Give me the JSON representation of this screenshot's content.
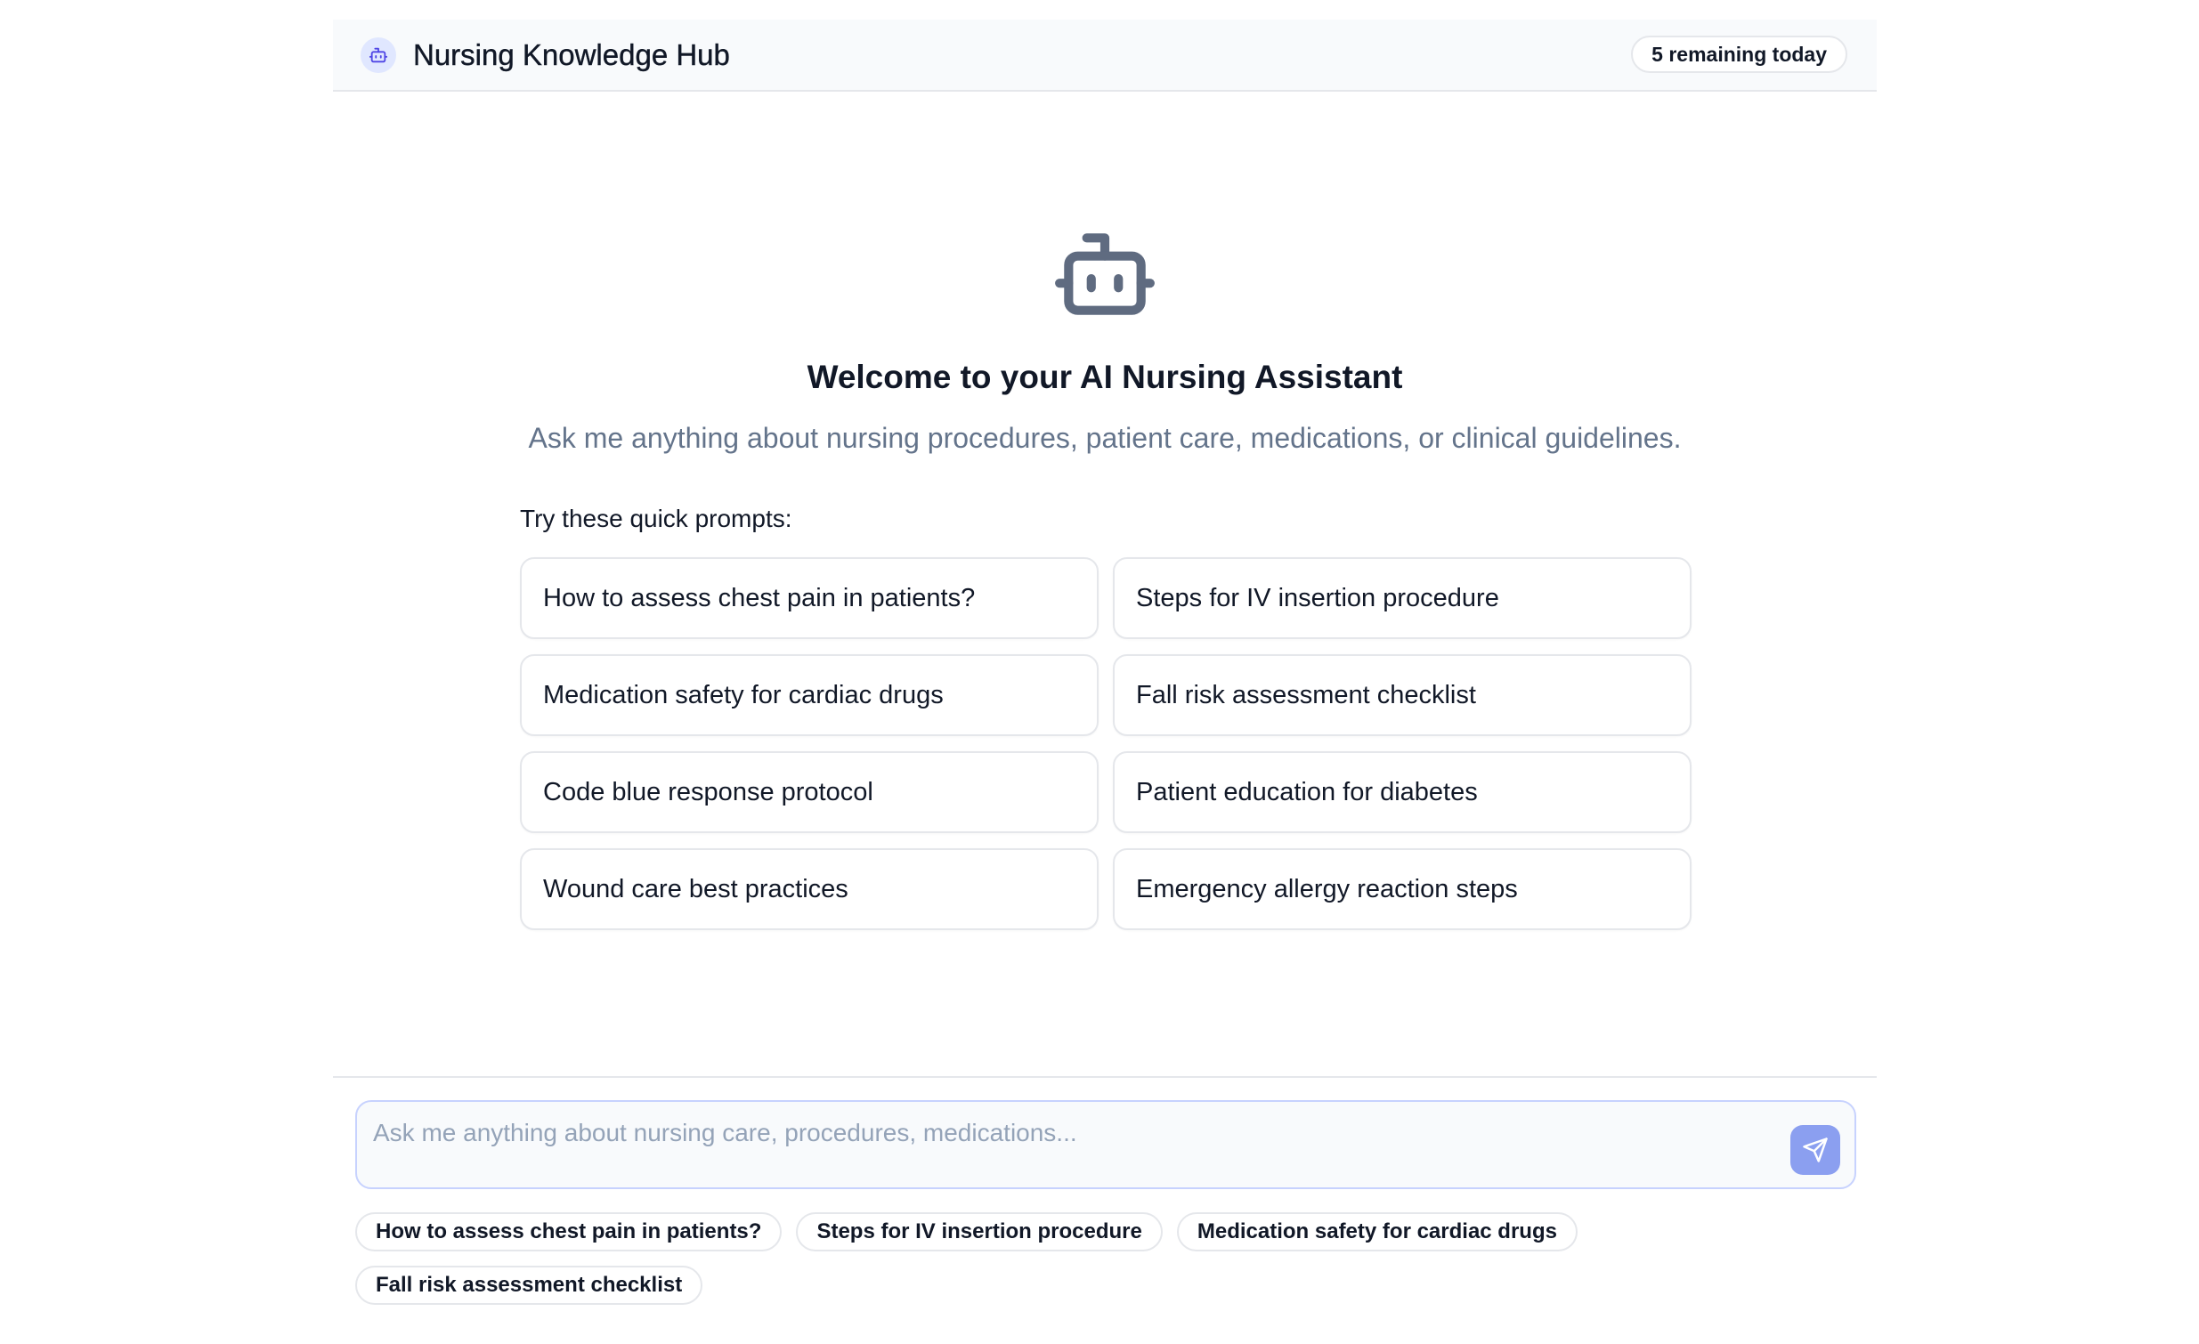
{
  "header": {
    "title": "Nursing Knowledge Hub",
    "logo_icon": "robot-icon",
    "remaining": "5 remaining today"
  },
  "welcome": {
    "icon": "robot-icon",
    "title": "Welcome to your AI Nursing Assistant",
    "subtitle": "Ask me anything about nursing procedures, patient care, medications, or clinical guidelines."
  },
  "quick_prompts": {
    "label": "Try these quick prompts:",
    "items": [
      "How to assess chest pain in patients?",
      "Steps for IV insertion procedure",
      "Medication safety for cardiac drugs",
      "Fall risk assessment checklist",
      "Code blue response protocol",
      "Patient education for diabetes",
      "Wound care best practices",
      "Emergency allergy reaction steps"
    ]
  },
  "composer": {
    "placeholder": "Ask me anything about nursing care, procedures, medications...",
    "value": "",
    "send_icon": "paper-plane-icon"
  },
  "suggestion_chips": [
    "How to assess chest pain in patients?",
    "Steps for IV insertion procedure",
    "Medication safety for cardiac drugs",
    "Fall risk assessment checklist"
  ],
  "colors": {
    "accent": "#8b9ff0",
    "logo_bg": "#e0e7ff",
    "logo_fg": "#4f46e5",
    "hero_icon": "#5f6b80",
    "muted_text": "#64748b",
    "border": "#e5e7eb"
  }
}
